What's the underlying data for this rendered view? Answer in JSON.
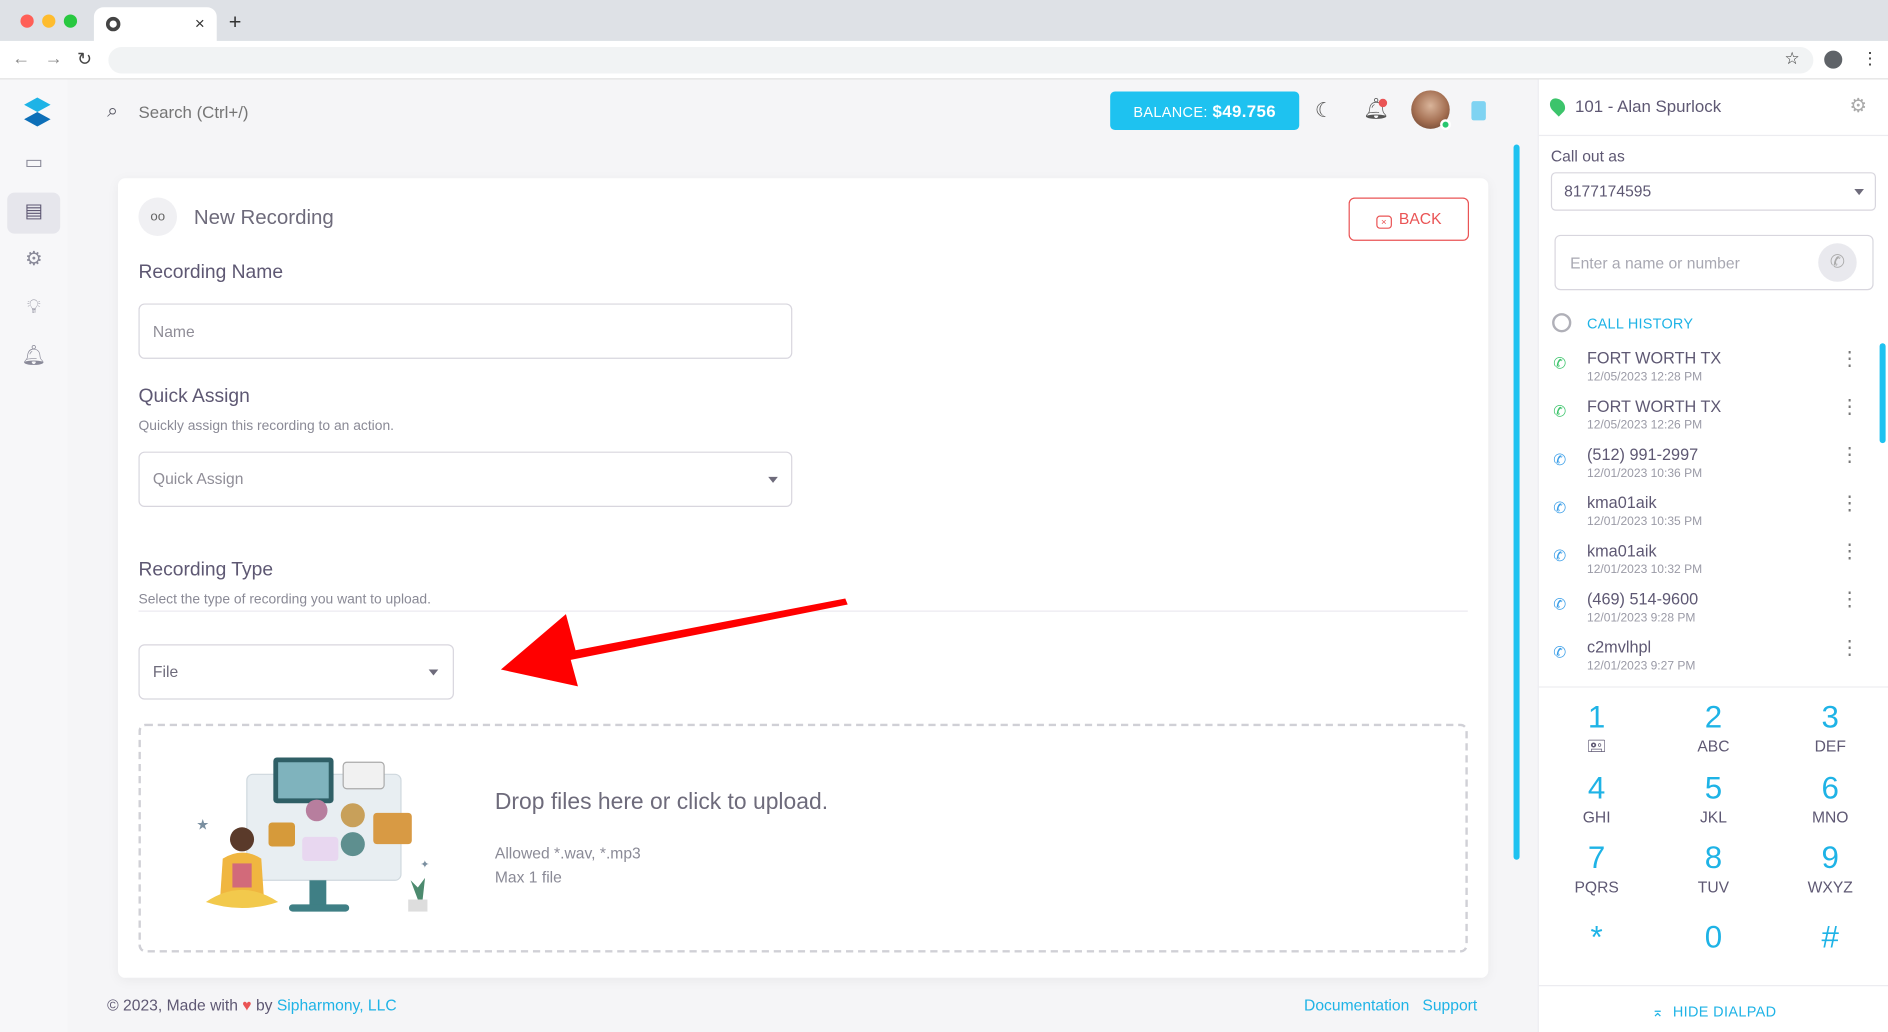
{
  "browser": {
    "tab_close": "×",
    "new_tab": "+",
    "nav_back": "←",
    "nav_forward": "→",
    "reload": "↻",
    "bookmark": "☆",
    "menu": "⋮"
  },
  "topbar": {
    "search_placeholder": "Search (Ctrl+/)",
    "balance_label": "BALANCE:",
    "balance_value": "$49.756"
  },
  "card": {
    "title": "New Recording",
    "back_label": "BACK",
    "recording_name": {
      "label": "Recording Name",
      "placeholder": "Name"
    },
    "quick_assign": {
      "label": "Quick Assign",
      "help": "Quickly assign this recording to an action.",
      "placeholder": "Quick Assign"
    },
    "recording_type": {
      "label": "Recording Type",
      "help": "Select the type of recording you want to upload.",
      "value": "File"
    },
    "dropzone": {
      "title": "Drop files here or click to upload.",
      "allowed": "Allowed *.wav, *.mp3",
      "max": "Max 1 file"
    }
  },
  "footer": {
    "copyright": "© 2023, Made with",
    "by": "by",
    "company": "Sipharmony, LLC",
    "documentation": "Documentation",
    "support": "Support"
  },
  "phone": {
    "extension": "101 - Alan Spurlock",
    "call_out_label": "Call out as",
    "call_out_value": "8177174595",
    "dial_placeholder": "Enter a name or number",
    "history_title": "CALL HISTORY",
    "history": [
      {
        "name": "FORT WORTH TX",
        "date": "12/05/2023 12:28 PM",
        "kind": "incoming"
      },
      {
        "name": "FORT WORTH TX",
        "date": "12/05/2023 12:26 PM",
        "kind": "incoming"
      },
      {
        "name": "(512) 991-2997",
        "date": "12/01/2023 10:36 PM",
        "kind": "outgoing"
      },
      {
        "name": "kma01aik",
        "date": "12/01/2023 10:35 PM",
        "kind": "outgoing"
      },
      {
        "name": "kma01aik",
        "date": "12/01/2023 10:32 PM",
        "kind": "outgoing"
      },
      {
        "name": "(469) 514-9600",
        "date": "12/01/2023 9:28 PM",
        "kind": "outgoing"
      },
      {
        "name": "c2mvlhpl",
        "date": "12/01/2023 9:27 PM",
        "kind": "outgoing"
      }
    ],
    "keypad": [
      {
        "digit": "1",
        "letters": "🖭"
      },
      {
        "digit": "2",
        "letters": "ABC"
      },
      {
        "digit": "3",
        "letters": "DEF"
      },
      {
        "digit": "4",
        "letters": "GHI"
      },
      {
        "digit": "5",
        "letters": "JKL"
      },
      {
        "digit": "6",
        "letters": "MNO"
      },
      {
        "digit": "7",
        "letters": "PQRS"
      },
      {
        "digit": "8",
        "letters": "TUV"
      },
      {
        "digit": "9",
        "letters": "WXYZ"
      },
      {
        "digit": "*",
        "letters": ""
      },
      {
        "digit": "0",
        "letters": ""
      },
      {
        "digit": "#",
        "letters": ""
      }
    ],
    "hide_dialpad": "HIDE DIALPAD"
  },
  "colors": {
    "accent": "#1ec2f0",
    "danger": "#ea5455",
    "incoming_call": "#3cc46b",
    "outgoing_call": "#3a9ee8",
    "annotation_arrow": "#ff0000"
  },
  "icons": [
    "search-icon",
    "moon-icon",
    "bell-icon",
    "gear-icon",
    "phone-icon",
    "clock-icon",
    "voicemail-icon",
    "close-icon",
    "heart-icon",
    "chevron-down-icon"
  ]
}
